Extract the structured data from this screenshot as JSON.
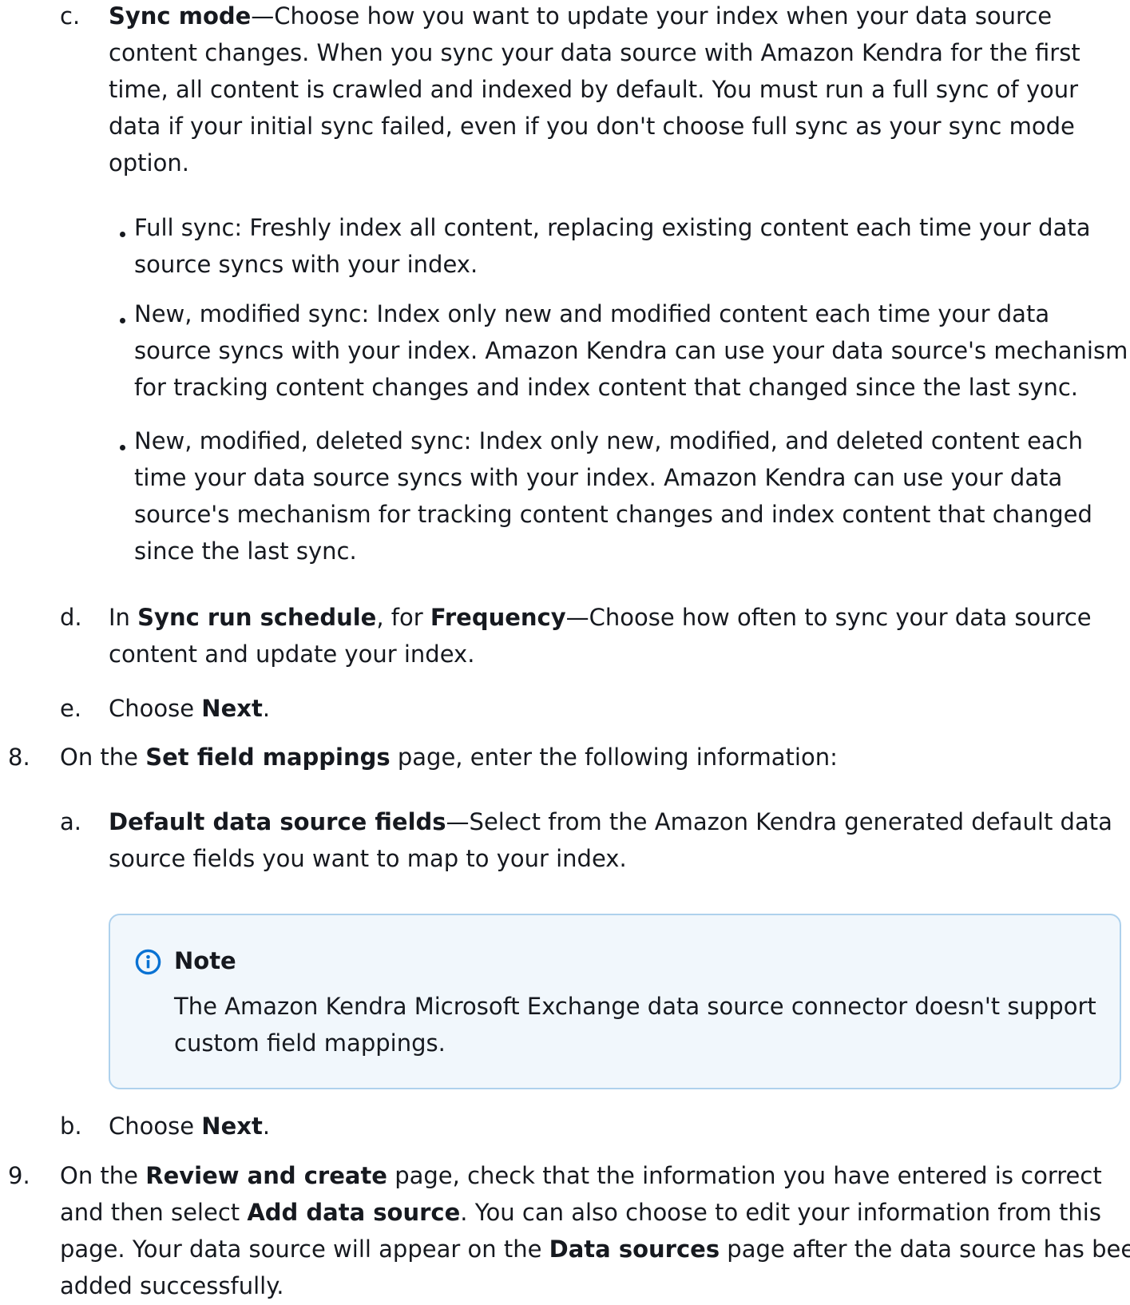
{
  "c": {
    "marker": "c.",
    "title": "Sync mode",
    "lines": [
      "—Choose how you want to update your index when your data source",
      "content changes. When you sync your data source with Amazon Kendra for the first",
      "time, all content is crawled and indexed by default. You must run a full sync of your",
      "data if your initial sync failed, even if you don't choose full sync as your sync mode",
      "option."
    ]
  },
  "bullets": [
    {
      "lines": [
        "Full sync: Freshly index all content, replacing existing content each time your data",
        "source syncs with your index."
      ]
    },
    {
      "lines": [
        "New, modified sync: Index only new and modified content each time your data",
        "source syncs with your index. Amazon Kendra can use your data source's mechanism",
        "for tracking content changes and index content that changed since the last sync."
      ]
    },
    {
      "lines": [
        "New, modified, deleted sync: Index only new, modified, and deleted content each",
        "time your data source syncs with your index. Amazon Kendra can use your data",
        "source's mechanism for tracking content changes and index content that changed",
        "since the last sync."
      ]
    }
  ],
  "d": {
    "marker": "d.",
    "pre": "In ",
    "b1": "Sync run schedule",
    "mid": ", for ",
    "b2": "Frequency",
    "post": "—Choose how often to sync your data source",
    "line2": "content and update your index."
  },
  "e": {
    "marker": "e.",
    "pre": "Choose ",
    "bold": "Next",
    "post": "."
  },
  "step8": {
    "marker": "8.",
    "pre": "On the ",
    "bold": "Set field mappings",
    "post": " page, enter the following information:",
    "a": {
      "marker": "a.",
      "bold": "Default data source fields",
      "post": "—Select from the Amazon Kendra generated default data",
      "line2": "source fields you want to map to your index."
    },
    "note": {
      "title": "Note",
      "line1": "The Amazon Kendra Microsoft Exchange data source connector doesn't support",
      "line2": "custom field mappings."
    },
    "b": {
      "marker": "b.",
      "pre": "Choose ",
      "bold": "Next",
      "post": "."
    }
  },
  "step9": {
    "marker": "9.",
    "pre": "On the ",
    "b1": "Review and create",
    "post1": " page, check that the information you have entered is correct",
    "l2pre": "and then select ",
    "b2": "Add data source",
    "l2post": ". You can also choose to edit your information from this",
    "l3pre": "page. Your data source will appear on the ",
    "b3": "Data sources",
    "l3post": " page after the data source has been",
    "l4": "added successfully."
  },
  "colors": {
    "text": "#16191f",
    "note_bg": "#f1f7fc",
    "note_border": "#aed1ed",
    "info_icon": "#0972d3"
  },
  "icons": {
    "note": "info-circle-icon"
  }
}
